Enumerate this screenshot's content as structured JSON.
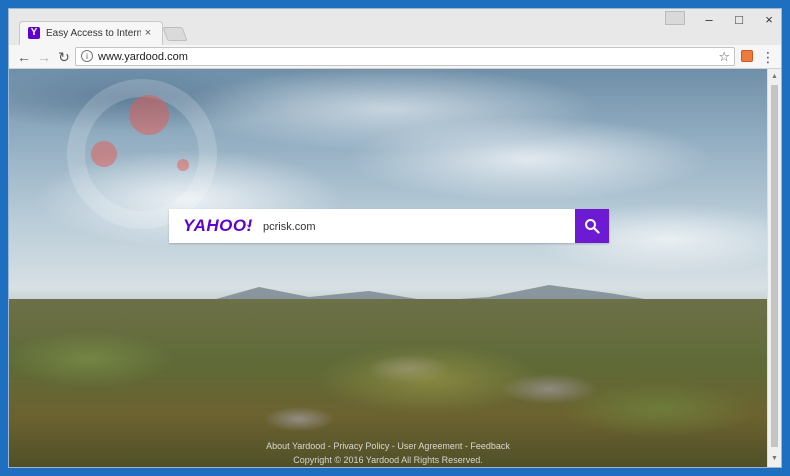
{
  "browser": {
    "tab": {
      "favicon": "Y",
      "title": "Easy Access to Internet S",
      "close": "×"
    },
    "window_controls": {
      "minimize": "–",
      "maximize": "□",
      "close": "×"
    },
    "toolbar": {
      "back": "←",
      "forward": "→",
      "reload": "↻",
      "info_icon": "i",
      "url": "www.yardood.com",
      "star": "☆",
      "menu": "⋮"
    }
  },
  "page": {
    "logo": "YAHOO!",
    "logo_caret": "⌄",
    "search_value": "pcrisk.com",
    "footer": {
      "links": [
        "About Yardood",
        "Privacy Policy",
        "User Agreement",
        "Feedback"
      ],
      "separator": " - ",
      "copyright": "Copyright © 2016 Yardood All Rights Reserved."
    }
  },
  "colors": {
    "brand": "#5f01d1",
    "search_button": "#6d1bd2"
  }
}
